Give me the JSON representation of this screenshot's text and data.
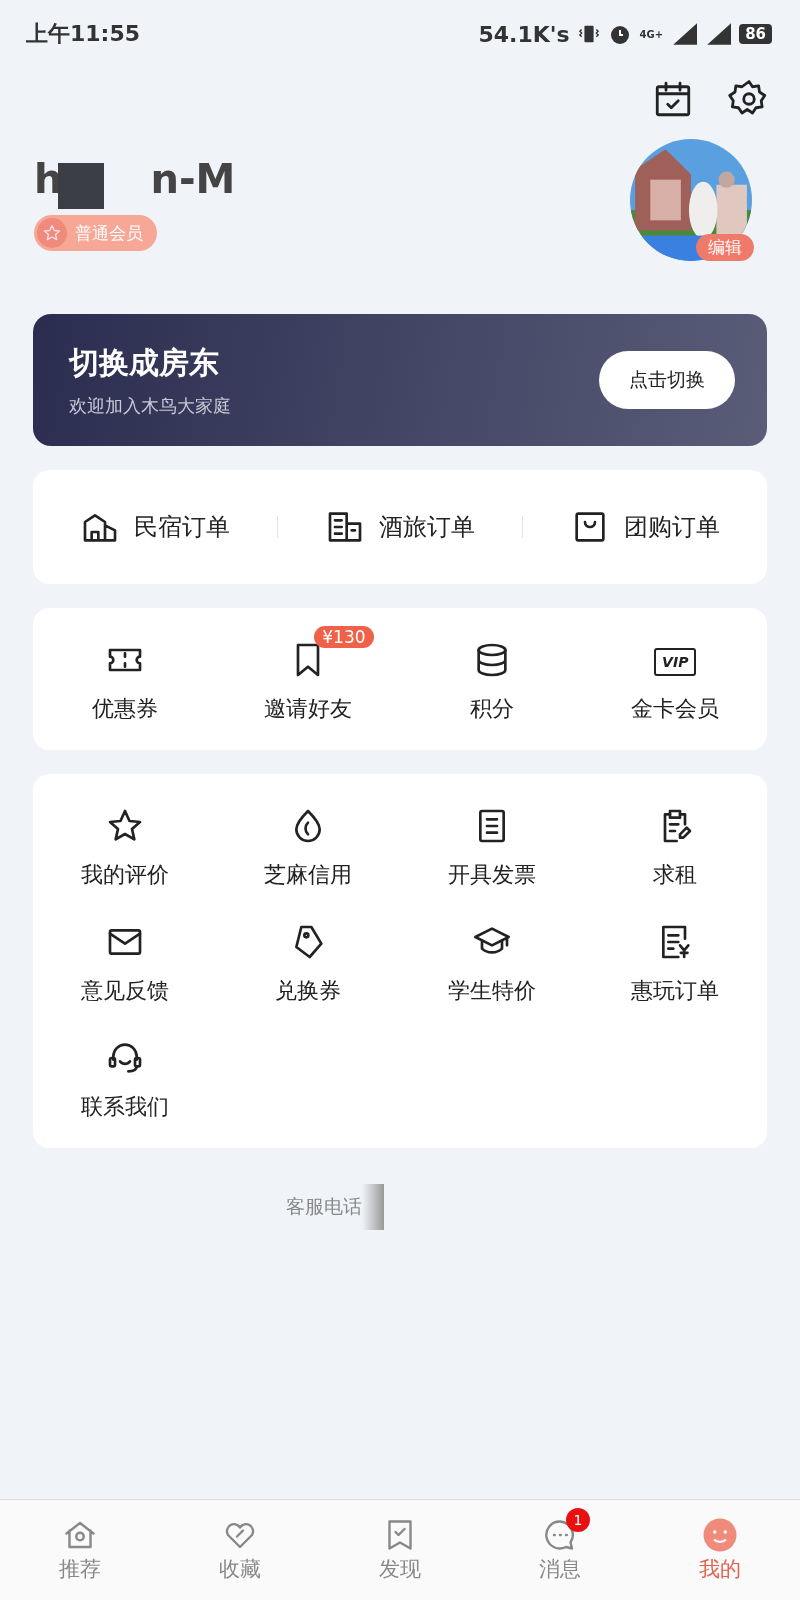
{
  "status_bar": {
    "time": "上午11:55",
    "net_speed": "54.1K's",
    "network": "4G+",
    "battery": "86"
  },
  "profile": {
    "name_parts": [
      "h",
      "n-M"
    ],
    "member_badge": "普通会员",
    "edit_label": "编辑"
  },
  "banner": {
    "title": "切换成房东",
    "subtitle": "欢迎加入木鸟大家庭",
    "button": "点击切换"
  },
  "orders": [
    {
      "label": "民宿订单"
    },
    {
      "label": "酒旅订单"
    },
    {
      "label": "团购订单"
    }
  ],
  "benefits": [
    {
      "label": "优惠券"
    },
    {
      "label": "邀请好友",
      "badge": "¥130"
    },
    {
      "label": "积分"
    },
    {
      "label": "金卡会员",
      "icon_text": "VIP"
    }
  ],
  "services": [
    {
      "label": "我的评价"
    },
    {
      "label": "芝麻信用"
    },
    {
      "label": "开具发票"
    },
    {
      "label": "求租"
    },
    {
      "label": "意见反馈"
    },
    {
      "label": "兑换券"
    },
    {
      "label": "学生特价"
    },
    {
      "label": "惠玩订单"
    },
    {
      "label": "联系我们"
    }
  ],
  "customer_service": "客服电话",
  "tabs": [
    {
      "label": "推荐",
      "selected": false
    },
    {
      "label": "收藏",
      "selected": false
    },
    {
      "label": "发现",
      "selected": false
    },
    {
      "label": "消息",
      "selected": false,
      "badge": "1"
    },
    {
      "label": "我的",
      "selected": true
    }
  ]
}
